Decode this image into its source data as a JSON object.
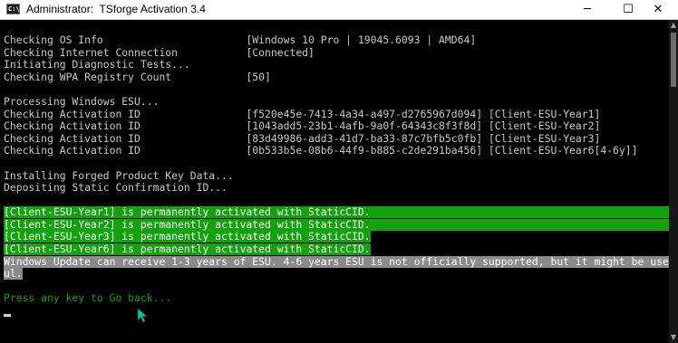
{
  "window": {
    "icon_text": "C:\\",
    "title": "Administrator:  TSforge Activation 3.4",
    "controls": {
      "minimize": "─",
      "maximize": "☐",
      "close": "✕"
    }
  },
  "console": {
    "lines": [
      "Checking OS Info                       [Windows 10 Pro | 19045.6093 | AMD64]",
      "Checking Internet Connection           [Connected]",
      "Initiating Diagnostic Tests...",
      "Checking WPA Registry Count            [50]",
      "",
      "Processing Windows ESU...",
      "Checking Activation ID                 [f520e45e-7413-4a34-a497-d2765967d094] [Client-ESU-Year1]",
      "Checking Activation ID                 [1043add5-23b1-4afb-9a0f-64343c8f3f8d] [Client-ESU-Year2]",
      "Checking Activation ID                 [83d49986-add3-41d7-ba33-87c7bfb5c0fb] [Client-ESU-Year3]",
      "Checking Activation ID                 [0b533b5e-08b6-44f9-b885-c2de291ba456] [Client-ESU-Year6[4-6y]]",
      "",
      "Installing Forged Product Key Data...",
      "Depositing Static Confirmation ID...",
      "",
      "[Client-ESU-Year1] is permanently activated with StaticCID.",
      "[Client-ESU-Year2] is permanently activated with StaticCID.",
      "[Client-ESU-Year3] is permanently activated with StaticCID.",
      "[Client-ESU-Year6] is permanently activated with StaticCID.",
      "Windows Update can receive 1-3 years of ESU. 4-6 years ESU is not officially supported, but it might be usef",
      "ul.",
      "",
      "Press any key to Go back..."
    ]
  },
  "colors": {
    "console_bg": "#000000",
    "text": "#c8c8c8",
    "success_bg": "#13a10e",
    "note_bg": "#8a8a8a",
    "prompt": "#13a10e"
  },
  "scrollbar": {
    "up": "▲",
    "down": "▼"
  }
}
